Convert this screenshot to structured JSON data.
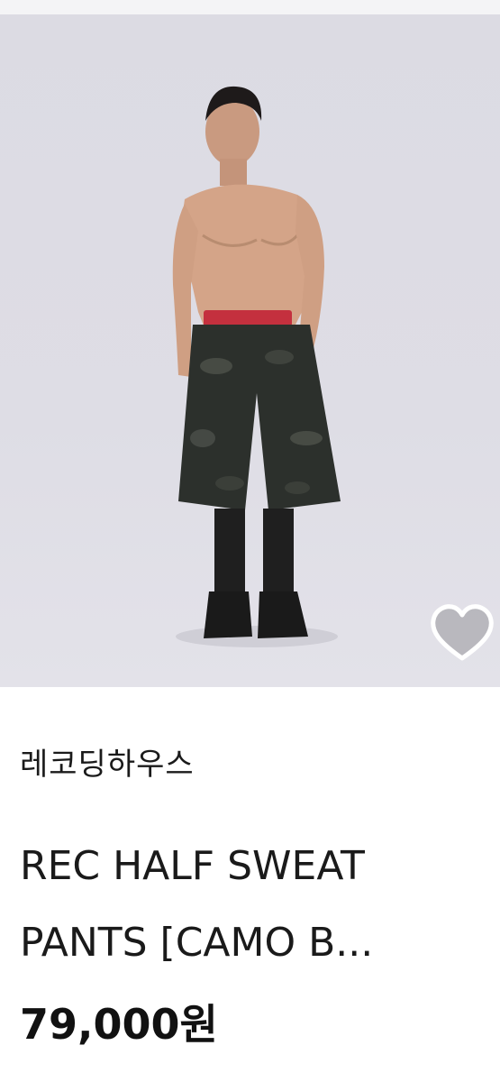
{
  "product": {
    "seller": "레코딩하우스",
    "title_line1": "REC HALF SWEAT",
    "title_line2": "PANTS [CAMO B...",
    "price": "79,000원",
    "image_icon": "product-photo",
    "like_icon": "heart-outline-icon"
  },
  "colors": {
    "background": "#ffffff",
    "photo_bg": "#dedde5",
    "text": "#1a1a1a",
    "heart_stroke": "#ffffff"
  }
}
